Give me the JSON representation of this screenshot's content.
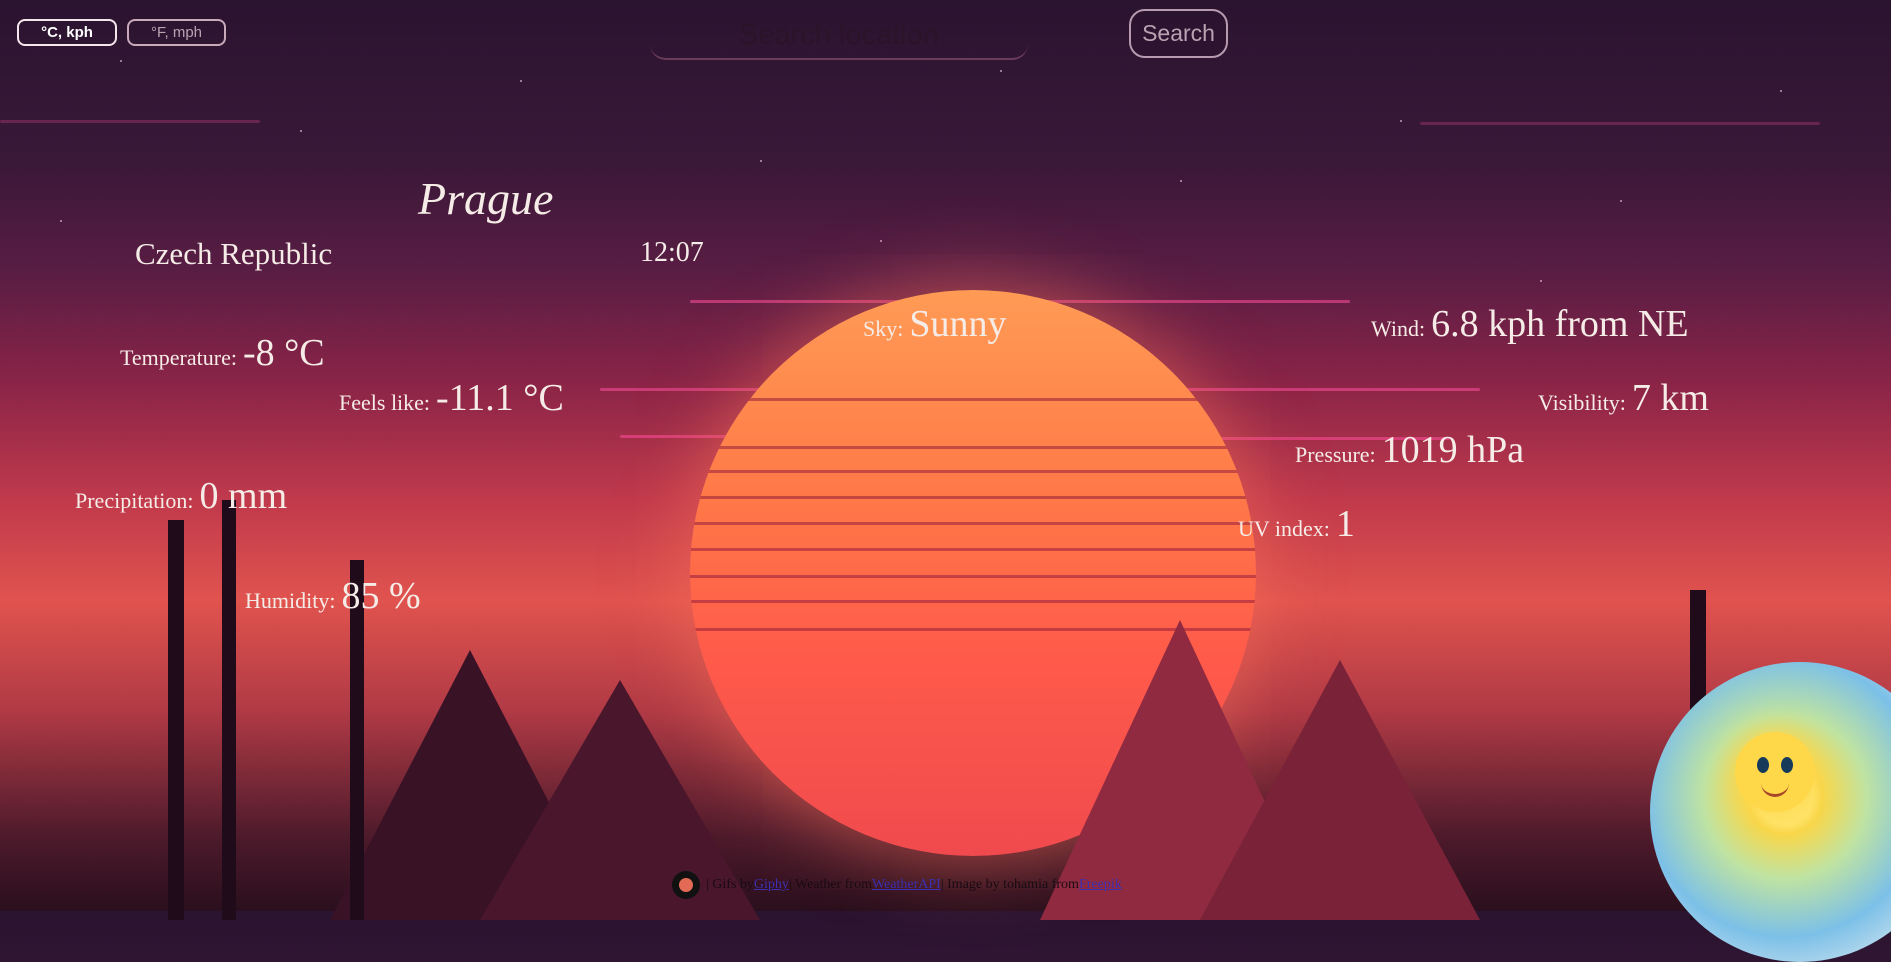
{
  "units": {
    "metric_label": "°C, kph",
    "imperial_label": "°F, mph",
    "selected": "metric"
  },
  "search": {
    "placeholder": "Search location",
    "button_label": "Search"
  },
  "location": {
    "city": "Prague",
    "country": "Czech Republic",
    "local_time": "12:07"
  },
  "stats": {
    "temperature": {
      "label": "Temperature:",
      "value": "-8 °C"
    },
    "feels_like": {
      "label": "Feels like:",
      "value": "-11.1 °C"
    },
    "precipitation": {
      "label": "Precipitation:",
      "value": "0 mm"
    },
    "humidity": {
      "label": "Humidity:",
      "value": "85 %"
    },
    "sky": {
      "label": "Sky:",
      "value": "Sunny"
    },
    "wind": {
      "label": "Wind:",
      "value": "6.8 kph from NE"
    },
    "visibility": {
      "label": "Visibility:",
      "value": "7 km"
    },
    "pressure": {
      "label": "Pressure:",
      "value": "1019 hPa"
    },
    "uv_index": {
      "label": "UV index:",
      "value": "1"
    }
  },
  "footer": {
    "sep1": " | Gifs by ",
    "gifs_link": "Giphy",
    "sep2": " | Weather from ",
    "weather_link": "WeatherAPI",
    "sep3": " | Image by tohamia from ",
    "image_link": "Freepik"
  },
  "icons": {
    "github": "github-icon",
    "weather_gif": "sun-face-icon"
  },
  "colors": {
    "text": "#f6ece7",
    "sun_top": "#ff9b55",
    "sun_bottom": "#f04a4e",
    "link": "#3c2fb0"
  }
}
